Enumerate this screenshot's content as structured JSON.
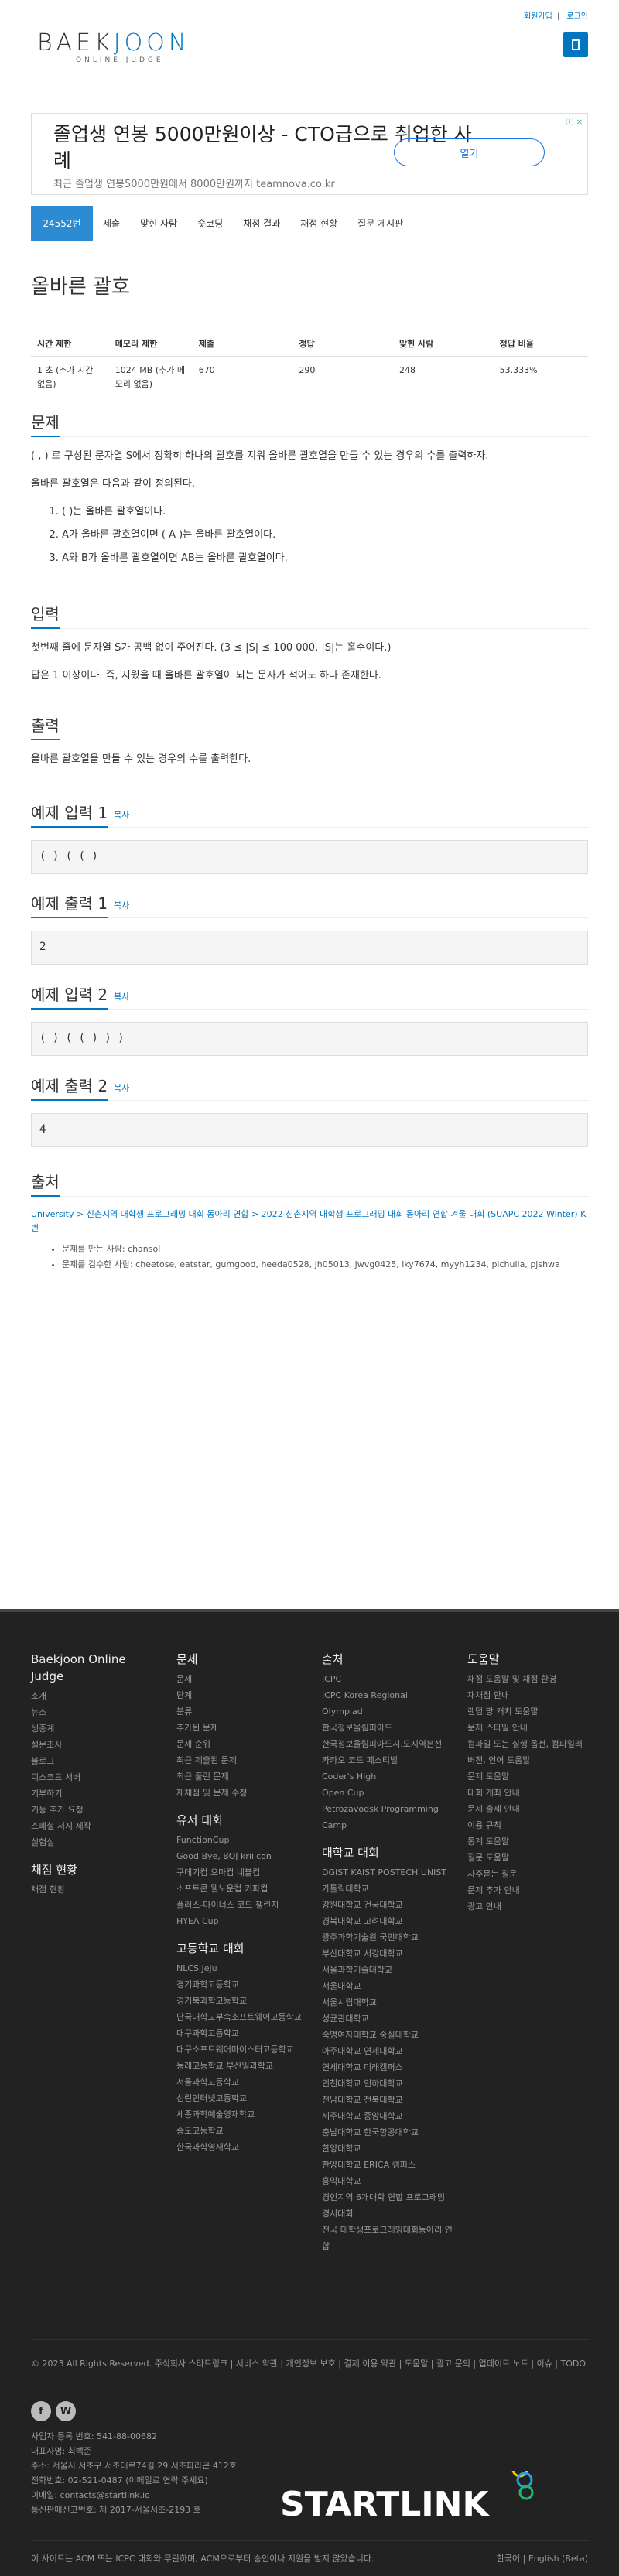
{
  "top_links": [
    "회원가입",
    "로그인"
  ],
  "logo": {
    "main_a": "BAEK",
    "main_b": "JOON",
    "sub": "ONLINE JUDGE"
  },
  "ad": {
    "headline": "졸업생 연봉 5000만원이상 - CTO급으로 취업한 사례",
    "sub": "최근 졸업생 연봉5000만원에서 8000만원까지 teamnova.co.kr",
    "button": "열기"
  },
  "tabs": [
    "24552번",
    "제출",
    "맞힌 사람",
    "숏코딩",
    "채점 결과",
    "채점 현황",
    "질문 게시판"
  ],
  "problem_title": "올바른 괄호",
  "info_headers": [
    "시간 제한",
    "메모리 제한",
    "제출",
    "정답",
    "맞힌 사람",
    "정답 비율"
  ],
  "info_values": [
    "1 초 (추가 시간 없음)",
    "1024 MB (추가 메모리 없음)",
    "670",
    "290",
    "248",
    "53.333%"
  ],
  "problem": {
    "heading": "문제",
    "p1": "( , ) 로 구성된 문자열 S에서 정확히 하나의 괄호를 지워 올바른 괄호열을 만들 수 있는 경우의 수를 출력하자.",
    "p2": "올바른 괄호열은 다음과 같이 정의된다.",
    "items": [
      "( )는 올바른 괄호열이다.",
      "A가 올바른 괄호열이면 ( A )는 올바른 괄호열이다.",
      "A와 B가 올바른 괄호열이면 AB는 올바른 괄호열이다."
    ]
  },
  "input": {
    "heading": "입력",
    "p1": "첫번째 줄에 문자열 S가 공백 없이 주어진다. (3 ≤ |S| ≤ 100 000, |S|는 홀수이다.)",
    "p2": "답은 1 이상이다. 즉, 지웠을 때 올바른 괄호열이 되는 문자가 적어도 하나 존재한다."
  },
  "output": {
    "heading": "출력",
    "p1": "올바른 괄호열을 만들 수 있는 경우의 수를 출력한다."
  },
  "copy_label": "복사",
  "examples": [
    {
      "heading": "예제 입력 1",
      "value": "( ) ( ( )"
    },
    {
      "heading": "예제 출력 1",
      "value": "2"
    },
    {
      "heading": "예제 입력 2",
      "value": "( ) ( ( ) ) )"
    },
    {
      "heading": "예제 출력 2",
      "value": "4"
    }
  ],
  "source": {
    "heading": "출처",
    "line": "University > 신촌지역 대학생 프로그래밍 대회 동아리 연합 > 2022 신촌지역 대학생 프로그래밍 대회 동아리 연합 겨울 대회 (SUAPC 2022 Winter) K번",
    "made": "문제를 만든 사람: chansol",
    "reviewed": "문제를 검수한 사람: cheetose, eatstar, gumgood, heeda0528, jh05013, jwvg0425, lky7674, myyh1234, pichulia, pjshwa"
  },
  "footer": {
    "col1": {
      "title": "Baekjoon Online Judge",
      "items": [
        "소개",
        "뉴스",
        "생중계",
        "설문조사",
        "블로그",
        "디스코드 서버",
        "기부하기",
        "기능 추가 요청",
        "스페셜 저지 제작",
        "실험실"
      ],
      "title2": "채점 현황",
      "items2": [
        "채점 현황"
      ]
    },
    "col2": {
      "title": "문제",
      "items": [
        "문제",
        "단계",
        "분류",
        "추가된 문제",
        "문제 순위",
        "최근 제출된 문제",
        "최근 풀린 문제",
        "재채점 및 문제 수정"
      ],
      "title2": "유저 대회",
      "items2": [
        "FunctionCup",
        "Good Bye, BOJ kriiicon",
        "구데기컵 오마컵 네블컵",
        "소프트콘 웰노운컵 키파컵",
        "플러스-마이너스 코드 챌린지",
        "HYEA Cup"
      ],
      "title3": "고등학교 대회",
      "items3": [
        "NLCS Jeju",
        "경기과학고등학교",
        "경기북과학고등학교",
        "단국대학교부속소프트웨어고등학교",
        "대구과학고등학교",
        "대구소프트웨어마이스터고등학교",
        "동래고등학교 부산일과학교",
        "서울과학고등학교",
        "선린인터넷고등학교",
        "세종과학예술영재학교",
        "송도고등학교",
        "한국과학영재학교"
      ]
    },
    "col3": {
      "title": "출처",
      "items": [
        "ICPC",
        "ICPC Korea Regional",
        "Olympiad",
        "한국정보올림피아드",
        "한국정보올림피아드시.도지역본선",
        "카카오 코드 페스티벌",
        "Coder's High",
        "Open Cup",
        "Petrozavodsk Programming Camp"
      ],
      "title2": "대학교 대회",
      "items2": [
        "DGIST KAIST POSTECH UNIST 가톨릭대학교",
        "강원대학교 건국대학교",
        "경북대학교 고려대학교",
        "광주과학기술원 국민대학교",
        "부산대학교 서강대학교",
        "서울과학기술대학교",
        "서울대학교",
        "서울시립대학교",
        "성균관대학교",
        "숙명여자대학교 숭실대학교",
        "아주대학교 연세대학교",
        "연세대학교 미래캠퍼스",
        "인천대학교 인하대학교",
        "전남대학교 전북대학교",
        "제주대학교 중앙대학교",
        "충남대학교 한국항공대학교",
        "한양대학교",
        "한양대학교 ERICA 캠퍼스",
        "홍익대학교",
        "경인지역 6개대학 연합 프로그래밍 경시대회",
        "전국 대학생프로그래밍대회동아리 연합"
      ]
    },
    "col4": {
      "title": "도움말",
      "items": [
        "채점 도움말 및 채점 환경",
        "재채점 안내",
        "랜덤 망 캐치 도움말",
        "문제 스타일 안내",
        "컴파일 또는 실행 옵션, 컴파일러 버전, 언어 도움말",
        "문제 도움말",
        "대회 개최 안내",
        "문제 출제 안내",
        "이용 규칙",
        "통계 도움말",
        "질문 도움말",
        "자주묻는 질문",
        "문제 추가 안내",
        "광고 안내"
      ]
    },
    "bottom": "© 2023 All Rights Reserved. 주식회사 스타트링크 | 서비스 약관 | 개인정보 보호 | 결제 이용 약관 | 도움말 | 광고 문의 | 업데이트 노트 | 이슈 | TODO",
    "company": [
      "사업자 등록 번호: 541-88-00682",
      "대표자명: 최백준",
      "주소: 서울시 서초구 서초대로74길 29 서초파라곤 412호",
      "전화번호: 02-521-0487 (이메일로 연락 주세요)",
      "이메일: contacts@startlink.io",
      "통신판매신고번호: 제 2017-서울서초-2193 호"
    ],
    "disclaimer": "이 사이트는 ACM 또는 ICPC 대회와 무관하며, ACM으로부터 승인이나 지원을 받지 않았습니다.",
    "lang": "한국어 | English (Beta)",
    "brand": "STARTLINK"
  }
}
